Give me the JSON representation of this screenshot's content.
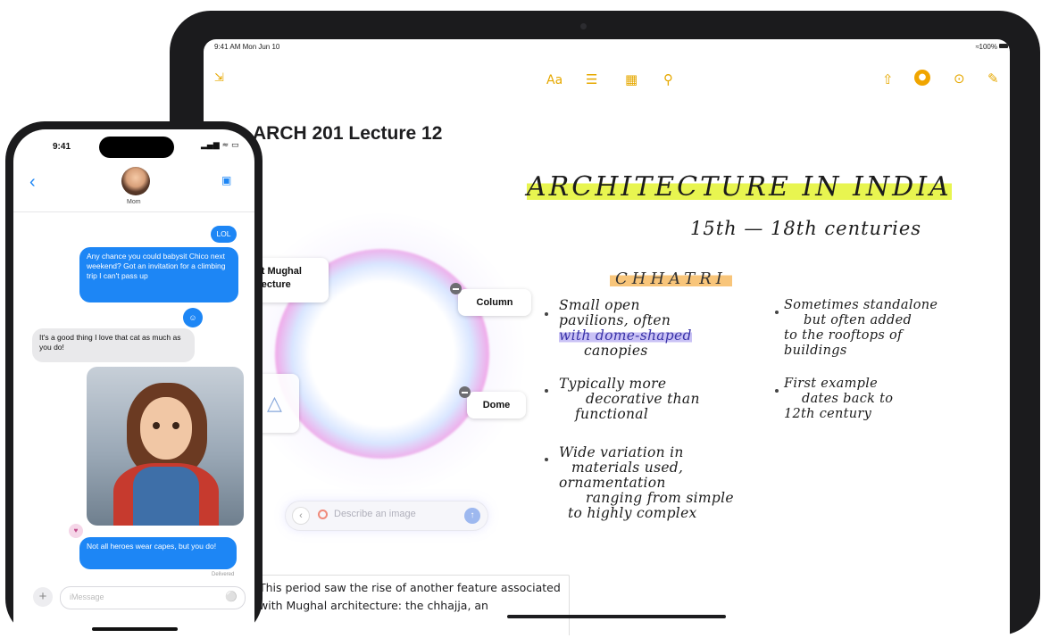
{
  "ipad": {
    "status": {
      "time_date": "9:41 AM  Mon Jun 10",
      "battery": "100%"
    },
    "toolbar": {
      "text_format": "Aa",
      "icons": [
        "collapse-icon",
        "checklist-icon",
        "table-icon",
        "attachment-icon",
        "share-icon",
        "collaborate-icon",
        "more-icon",
        "compose-icon"
      ]
    },
    "note": {
      "title": "ARCH 201 Lecture 12",
      "heading": "ARCHITECTURE IN INDIA",
      "subheading": "15th — 18th centuries",
      "topic": "CHHATRI",
      "bullets_left": [
        {
          "lines": [
            "Small open",
            "pavilions, often",
            "with dome-shaped",
            "canopies"
          ]
        },
        {
          "lines": [
            "Typically more",
            "decorative than",
            "functional"
          ]
        },
        {
          "lines": [
            "Wide variation in",
            "materials used,",
            "ornamentation",
            "ranging from simple",
            "to highly complex"
          ]
        }
      ],
      "bullets_right": [
        {
          "lines": [
            "Sometimes standalone",
            "but often added",
            "to the rooftops of",
            "buildings"
          ]
        },
        {
          "lines": [
            "First example",
            "dates back to",
            "12th century"
          ]
        }
      ],
      "typed_text": "This period saw the rise of another feature associated with Mughal architecture: the chhajja, an"
    },
    "image_wand": {
      "card_left": "nt Mughal\nitecture",
      "card_column": "Column",
      "card_dome": "Dome",
      "describe_placeholder": "Describe an image"
    }
  },
  "iphone": {
    "status": {
      "time": "9:41"
    },
    "contact": "Mom",
    "messages": [
      {
        "from": "me",
        "text": "LOL"
      },
      {
        "from": "me",
        "text": "Any chance you could babysit Chico next weekend? Got an invitation for a climbing trip I can't pass up"
      },
      {
        "from": "them",
        "text": "It's a good thing I love that cat as much as you do!"
      },
      {
        "from": "me",
        "text": "Not all heroes wear capes, but you do!"
      }
    ],
    "delivered": "Delivered",
    "input_placeholder": "iMessage"
  }
}
